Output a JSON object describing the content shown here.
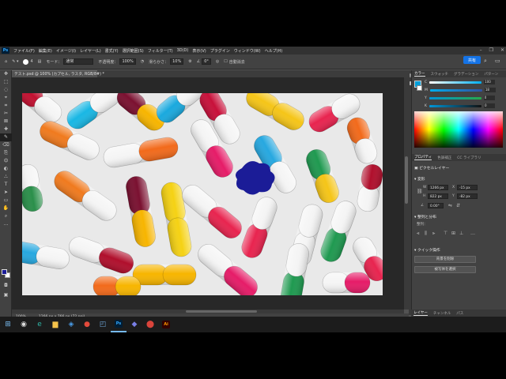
{
  "app": {
    "logo": "Ps",
    "menu": [
      "ファイル(F)",
      "編集(E)",
      "イメージ(I)",
      "レイヤー(L)",
      "書式(Y)",
      "選択範囲(S)",
      "フィルター(T)",
      "3D(D)",
      "表示(V)",
      "プラグイン",
      "ウィンドウ(W)",
      "ヘルプ(H)"
    ],
    "window_controls": [
      "–",
      "❐",
      "✕"
    ]
  },
  "options": {
    "brush_size": "4",
    "mode_label": "モード：",
    "mode_value": "通常",
    "opacity_label": "不透明度：",
    "opacity_value": "100%",
    "smoothing_label": "滑らかさ：",
    "smoothing_value": "10%",
    "angle_value": "0°",
    "auto_erase": "自動消去",
    "share_button": "共有"
  },
  "document": {
    "tab_title": "テスト.psd @ 100% (カプセル, ラスタ, RGB/8#) *",
    "zoom": "100%",
    "dimensions": "1266 px x 766 px (72 ppi)"
  },
  "toolbar": {
    "tools": [
      "✥",
      "⬚",
      "◌",
      "⌖",
      "⌗",
      "✂",
      "⊠",
      "✚",
      "✎",
      "⌫",
      "⎘",
      "⏣",
      "◐",
      "⛬",
      "T",
      "➤",
      "▭",
      "✋",
      "⌕",
      "…"
    ]
  },
  "colors": {
    "foreground": "#1b1c97",
    "background": "#ffffff",
    "accent": "#1473e6"
  },
  "color_panel": {
    "tabs": [
      "カラー",
      "スウォッチ",
      "グラデーション",
      "パターン"
    ],
    "channels": [
      {
        "label": "C",
        "value": "100"
      },
      {
        "label": "M",
        "value": "18"
      },
      {
        "label": "Y",
        "value": "0"
      },
      {
        "label": "K",
        "value": "0"
      }
    ]
  },
  "properties_panel": {
    "tabs": [
      "プロパティ",
      "色調補正",
      "CC ライブラリ"
    ],
    "layer_type": "ピクセルレイヤー",
    "transform_label": "変形",
    "w_label": "W",
    "w_value": "1266 px",
    "h_label": "H",
    "h_value": "822 px",
    "x_label": "X",
    "x_value": "-15 px",
    "y_label": "Y",
    "y_value": "-82 px",
    "angle_value": "0.00°",
    "align_label": "整列と分布",
    "align_sub": "整列：",
    "quick_label": "クイック操作",
    "remove_bg": "背景を削除",
    "select_subject": "被写体を選択"
  },
  "bottom_tabs": [
    "レイヤー",
    "チャンネル",
    "パス"
  ],
  "taskbar": {
    "items": [
      {
        "name": "windows-logo-icon",
        "glyph": "⊞",
        "color": "#76b9ed"
      },
      {
        "name": "search-icon",
        "glyph": "◉",
        "color": "#dddddd"
      },
      {
        "name": "edge-icon",
        "glyph": "e",
        "color": "#2fb5a6"
      },
      {
        "name": "file-explorer-icon",
        "glyph": "▆",
        "color": "#f5c34b"
      },
      {
        "name": "store-icon",
        "glyph": "◈",
        "color": "#4a9eea"
      },
      {
        "name": "chrome-icon",
        "glyph": "●",
        "color": "#e34a3b"
      },
      {
        "name": "photos-icon",
        "glyph": "◰",
        "color": "#6fa8dc"
      },
      {
        "name": "photoshop-icon",
        "glyph": "Ps",
        "color": "#31a8ff"
      },
      {
        "name": "teams-icon",
        "glyph": "◆",
        "color": "#7a80e6"
      },
      {
        "name": "record-icon",
        "glyph": "⬤",
        "color": "#d9443b"
      },
      {
        "name": "illustrator-icon",
        "glyph": "Ai",
        "color": "#ff9a00"
      }
    ]
  }
}
